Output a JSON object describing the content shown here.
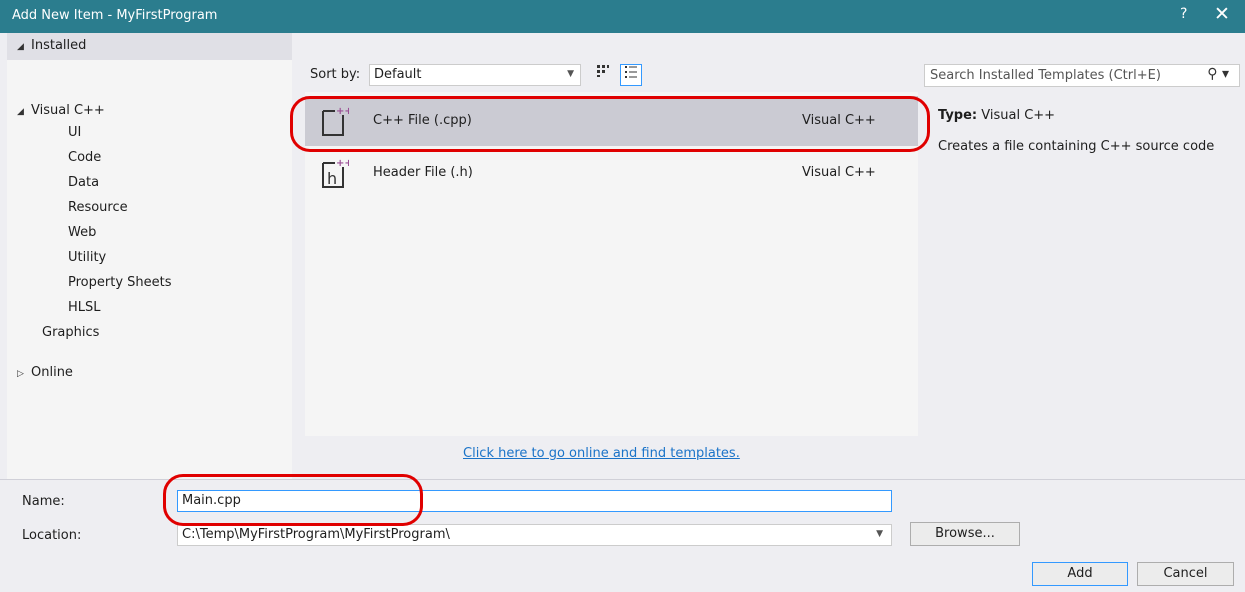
{
  "window": {
    "title": "Add New Item - MyFirstProgram",
    "help": "?",
    "close": "✕"
  },
  "tree": {
    "installed": "Installed",
    "root": "Visual C++",
    "children": [
      "UI",
      "Code",
      "Data",
      "Resource",
      "Web",
      "Utility",
      "Property Sheets",
      "HLSL"
    ],
    "graphics": "Graphics",
    "online": "Online"
  },
  "sort": {
    "label": "Sort by:",
    "value": "Default"
  },
  "search": {
    "placeholder": "Search Installed Templates (Ctrl+E)"
  },
  "templates": [
    {
      "name": "C++ File (.cpp)",
      "lang": "Visual C++",
      "icon": "cpp-file-icon"
    },
    {
      "name": "Header File (.h)",
      "lang": "Visual C++",
      "icon": "header-file-icon"
    }
  ],
  "online_link": "Click here to go online and find templates.",
  "info": {
    "type_label": "Type:",
    "type_value": "Visual C++",
    "description": "Creates a file containing C++ source code"
  },
  "form": {
    "name_label": "Name:",
    "name_value": "Main.cpp",
    "location_label": "Location:",
    "location_value": "C:\\Temp\\MyFirstProgram\\MyFirstProgram\\",
    "browse": "Browse...",
    "add": "Add",
    "cancel": "Cancel"
  },
  "colors": {
    "titlebar": "#2b7d8e",
    "selection": "#cbcbd3",
    "link": "#1a73c8",
    "annotation": "#e00000",
    "icon_accent": "#9b4f96"
  }
}
